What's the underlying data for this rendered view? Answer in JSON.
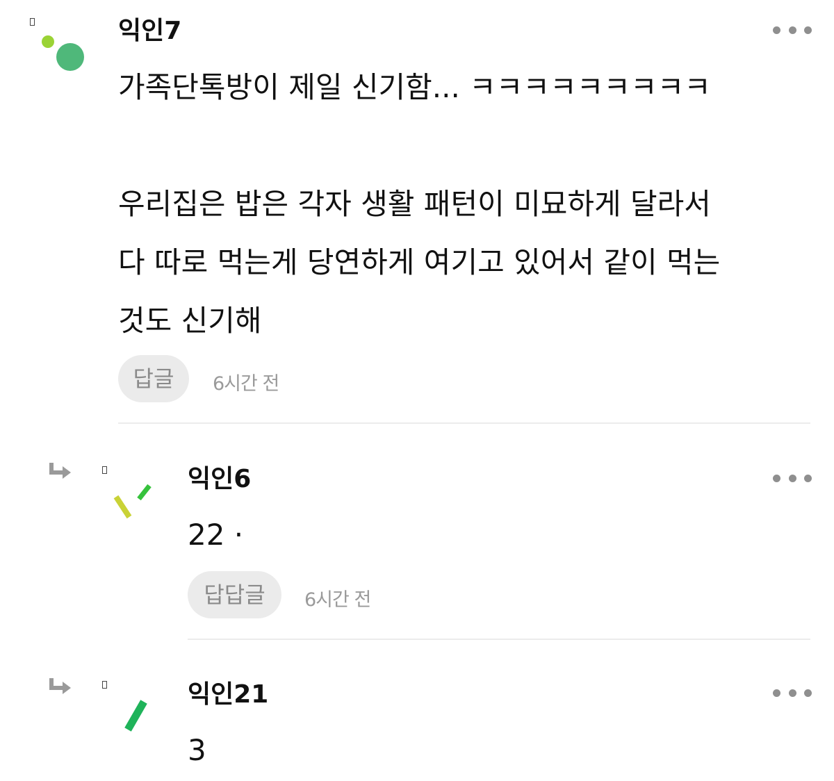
{
  "comments": [
    {
      "author": "익인7",
      "body": "가족단톡방이 제일 신기함... ㅋㅋㅋㅋㅋㅋㅋㅋㅋ\n\n우리집은 밥은 각자 생활 패턴이 미묘하게 달라서\n다 따로 먹는게 당연하게 여기고 있어서 같이 먹는\n것도 신기해",
      "reply_label": "답글",
      "time": "6시간 전",
      "avatar_colors": [
        "#9ad335",
        "#4fb87a"
      ]
    },
    {
      "author": "익인6",
      "body": "22 ·",
      "reply_label": "답답글",
      "time": "6시간 전",
      "avatar_colors": [
        "#c9d236",
        "#36c23c"
      ]
    },
    {
      "author": "익인21",
      "body": "3",
      "avatar_colors": [
        "#1fb35a"
      ]
    }
  ],
  "icons": {
    "more": "more-horizontal-icon",
    "reply_arrow": "reply-arrow-icon"
  }
}
